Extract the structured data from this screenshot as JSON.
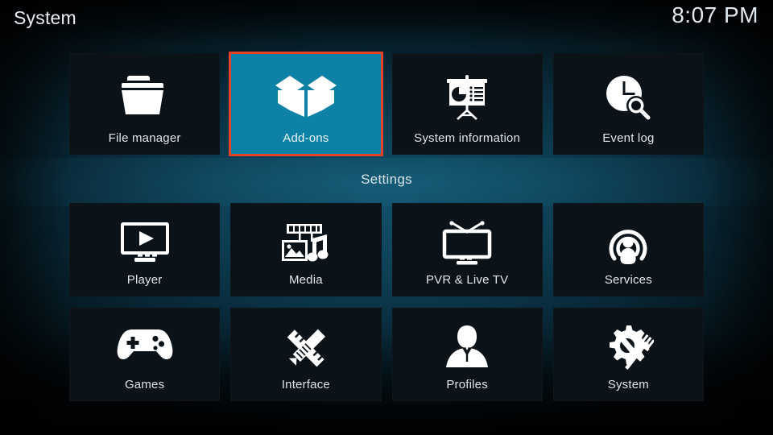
{
  "header": {
    "title": "System",
    "clock": "8:07 PM"
  },
  "section": {
    "settings_label": "Settings"
  },
  "colors": {
    "selection_border": "#e8412a",
    "selected_tile_bg": "#0e82a6",
    "tile_bg": "#0b1218",
    "text": "#dde6ec",
    "background_teal": "#11506a"
  },
  "rows": {
    "top": [
      {
        "label": "File manager",
        "icon": "folder-icon"
      },
      {
        "label": "Add-ons",
        "icon": "open-box-icon",
        "selected": true
      },
      {
        "label": "System information",
        "icon": "presentation-chart-icon"
      },
      {
        "label": "Event log",
        "icon": "clock-search-icon"
      }
    ],
    "middle": [
      {
        "label": "Player",
        "icon": "monitor-play-icon"
      },
      {
        "label": "Media",
        "icon": "filmstrip-photo-music-icon"
      },
      {
        "label": "PVR & Live TV",
        "icon": "tv-antenna-icon"
      },
      {
        "label": "Services",
        "icon": "broadcast-person-icon"
      }
    ],
    "bottom": [
      {
        "label": "Games",
        "icon": "gamepad-icon"
      },
      {
        "label": "Interface",
        "icon": "pencil-ruler-icon"
      },
      {
        "label": "Profiles",
        "icon": "person-bust-icon"
      },
      {
        "label": "System",
        "icon": "gear-tools-icon"
      }
    ]
  }
}
